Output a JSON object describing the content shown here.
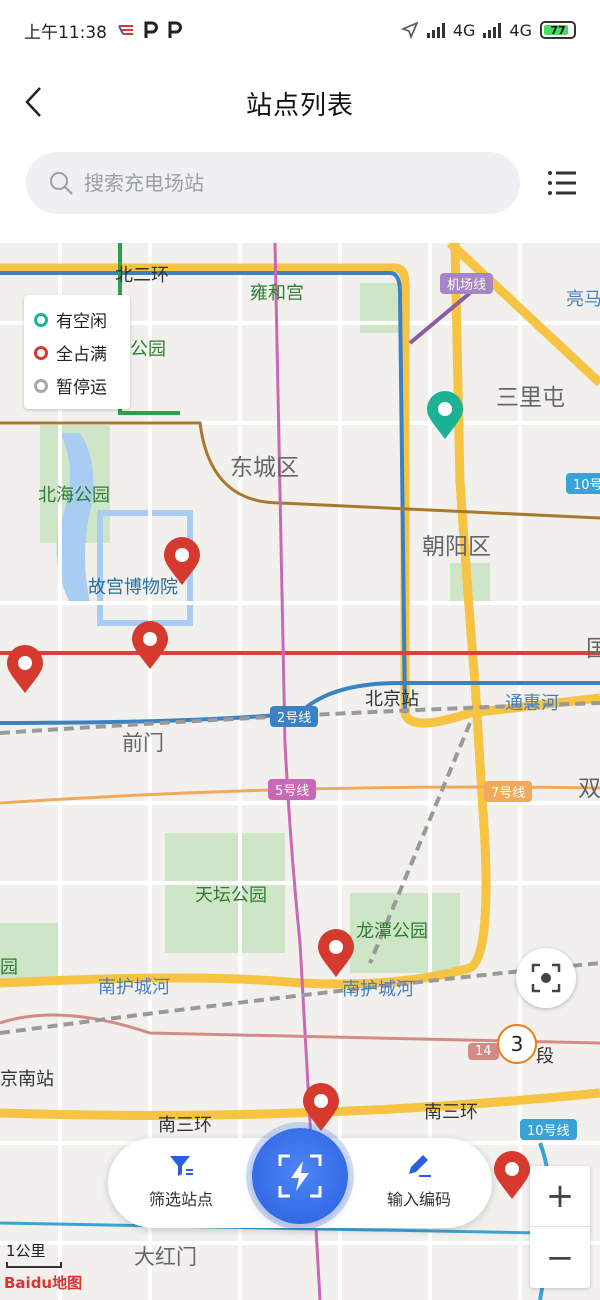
{
  "status_bar": {
    "time": "上午11:38",
    "network1": "4G",
    "network2": "4G",
    "battery": "77"
  },
  "header": {
    "title": "站点列表"
  },
  "search": {
    "placeholder": "搜索充电场站"
  },
  "legend": {
    "items": [
      {
        "label": "有空闲",
        "color": "#1bb394"
      },
      {
        "label": "全占满",
        "color": "#d63a2f"
      },
      {
        "label": "暂停运",
        "color": "#a8a8a8"
      }
    ]
  },
  "map": {
    "labels": {
      "beierhuan": "北二环",
      "yonghegong": "雍和宫",
      "jichangxian": "机场线",
      "liangma": "亮马",
      "gongyuan": "公园",
      "sanlitun": "三里屯",
      "dongchengqu": "东城区",
      "beihaigongyuan": "北海公园",
      "line10a": "10号",
      "chaoyangqu": "朝阳区",
      "gugong": "故宫博物院",
      "guo": "国",
      "beijingzhan": "北京站",
      "line2": "2号线",
      "tonghuihe": "通惠河",
      "qianmen": "前门",
      "line5": "5号线",
      "line7": "7号线",
      "shuang": "双",
      "tiantangongyuan": "天坛公园",
      "longtangongyuan": "龙潭公园",
      "yuan": "园",
      "nanhuchenghe1": "南护城河",
      "nanhuchenghe2": "南护城河",
      "nanzhan": "京南站",
      "num14": "14",
      "duan": "段",
      "nansanhuan1": "南三环",
      "nansanhuan2": "南三环",
      "line10b": "10号线",
      "dahongmen": "大红门"
    },
    "cluster_count": "3",
    "scale": "1公里",
    "logo": "Baidu地图"
  },
  "toolbar": {
    "filter_label": "筛选站点",
    "code_label": "输入编码"
  },
  "zoom": {
    "in": "+",
    "out": "−"
  }
}
